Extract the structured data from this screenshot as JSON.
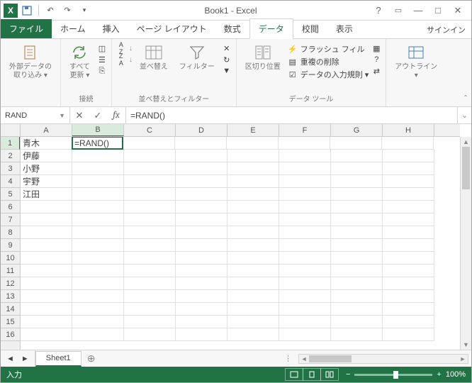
{
  "title": "Book1 - Excel",
  "qat": {
    "undo": "↶",
    "redo": "↷"
  },
  "signin": "サインイン",
  "tabs": {
    "file": "ファイル",
    "home": "ホーム",
    "insert": "挿入",
    "layout": "ページ レイアウト",
    "formulas": "数式",
    "data": "データ",
    "review": "校閲",
    "view": "表示"
  },
  "ribbon": {
    "external": {
      "label": "外部データの\n取り込み ▾"
    },
    "refresh": {
      "label": "すべて\n更新 ▾",
      "group": "接続"
    },
    "sort": {
      "az": "A↓Z",
      "za": "Z↓A",
      "btn": "並べ替え",
      "filter": "フィルター",
      "group": "並べ替えとフィルター"
    },
    "texttools": {
      "btn": "区切り位置",
      "flash": "フラッシュ フィル",
      "dup": "重複の削除",
      "validate": "データの入力規則 ▾",
      "group": "データ ツール"
    },
    "outline": {
      "label": "アウトライン\n▾"
    }
  },
  "namebox": "RAND",
  "formula": "=RAND()",
  "columns": [
    "A",
    "B",
    "C",
    "D",
    "E",
    "F",
    "G",
    "H"
  ],
  "rows": [
    "1",
    "2",
    "3",
    "4",
    "5",
    "6",
    "7",
    "8",
    "9",
    "10",
    "11",
    "12",
    "13",
    "14",
    "15",
    "16"
  ],
  "cells": {
    "A1": "青木",
    "A2": "伊藤",
    "A3": "小野",
    "A4": "宇野",
    "A5": "江田",
    "B1": "=RAND()"
  },
  "activeCell": "B1",
  "sheet": {
    "name": "Sheet1"
  },
  "status": {
    "mode": "入力",
    "zoom": "100%"
  }
}
